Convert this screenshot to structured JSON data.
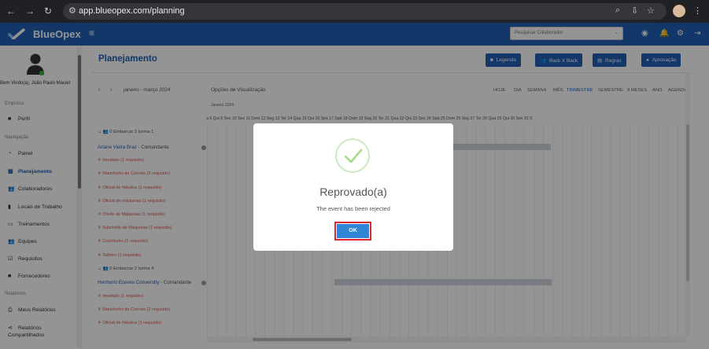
{
  "browser": {
    "url": "app.blueopex.com/planning"
  },
  "app": {
    "brand": "BlueOpex",
    "collaborator_placeholder": "Pesquisar Colaborador"
  },
  "sidebar": {
    "welcome": "Bem Vindo(a), João Paulo Maciel",
    "sections": {
      "empresa": "Empresa",
      "navegacao": "Navegação",
      "relatorios": "Relatórios"
    },
    "items": [
      {
        "label": "Perfil",
        "icon": "briefcase-icon"
      },
      {
        "label": "Painel",
        "icon": "gauge-icon"
      },
      {
        "label": "Planejamento",
        "icon": "calendar-icon",
        "active": true
      },
      {
        "label": "Colaboradores",
        "icon": "users-icon"
      },
      {
        "label": "Locais de Trabalho",
        "icon": "building-icon"
      },
      {
        "label": "Treinamentos",
        "icon": "training-icon"
      },
      {
        "label": "Equipes",
        "icon": "team-icon"
      },
      {
        "label": "Requisitos",
        "icon": "checkbox-icon"
      },
      {
        "label": "Fornecedores",
        "icon": "briefcase-icon"
      },
      {
        "label": "Meus Relatórios",
        "icon": "print-icon"
      },
      {
        "label": "Relatórios",
        "label2": "Compartilhados",
        "icon": "share-icon"
      }
    ]
  },
  "page": {
    "title": "Planejamento",
    "buttons": {
      "legenda": "Legenda",
      "back_x_back": "Back X Back",
      "regras": "Regras",
      "aprovacao": "Aprovação"
    }
  },
  "calendar": {
    "range": "janeiro - março 2024",
    "options": "Opções de Visualização",
    "views": [
      "HOJE",
      "DIA",
      "SEMANA",
      "MÊS",
      "TRIMESTRE",
      "SEMESTRE",
      "9 MESES",
      "ANO",
      "AGENDA"
    ],
    "active_view": "TRIMESTRE",
    "month_label": "Janeiro 2024",
    "days": "a 6 Qui 9 Sex 10 Sex 11 Dom 12 Seg 13 Ter 14 Qua 15 Qui 16 Sex 17 Sab 18 Dom 19 Seg 20 Ter 21 Qua 22 Qui 23 Sex 24 Sab 25 Dom 26 Seg 27 Ter 28 Qua 29 Qui 30 Sex 31 S",
    "groups": [
      {
        "label": "0 Embarcar 2 turma 1"
      },
      {
        "label": "0 Embarcar 2 turma 4"
      }
    ],
    "persons": [
      {
        "name": "Ariane Vieira Braz",
        "role": " - Comandante"
      },
      {
        "name": "Henhorio Eceves Conversby",
        "role": " - Comandante"
      }
    ],
    "requirements_a": [
      "Imediato (1 requisito)",
      "Marinheiro de Convés (2 requisito)",
      "Oficial de Náutica (1 requisito)",
      "Oficial de máquinas (1 requisito)",
      "Chefe de Máquinas (1 requisito)",
      "Subchefe de Máquinas (1 requisito)",
      "Cozinheiro (1 requisito)",
      "Taifeiro (1 requisito)"
    ],
    "requirements_b": [
      "Imediato (1 requisito)",
      "Marinheiro de Convés (2 requisito)",
      "Oficial de Náutica (1 requisito)"
    ]
  },
  "modal": {
    "title": "Reprovado(a)",
    "text": "The event has been rejected",
    "ok": "OK",
    "check_color": "#a5dc86",
    "button_color": "#3085d6",
    "highlight_color": "#e0252c"
  }
}
